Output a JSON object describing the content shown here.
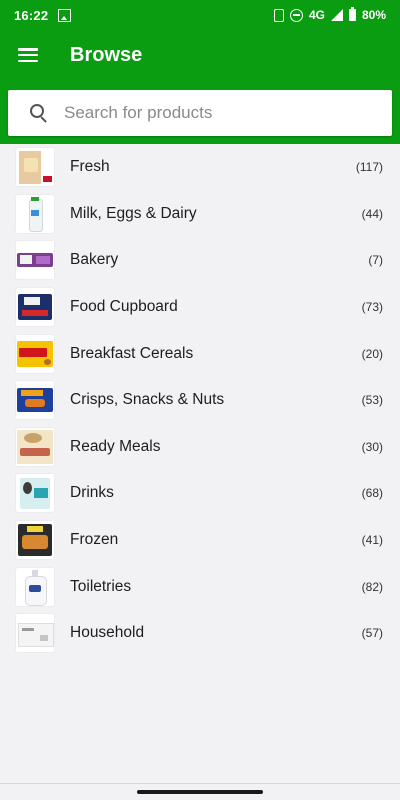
{
  "status_bar": {
    "time": "16:22",
    "network": "4G",
    "battery": "80%"
  },
  "app_bar": {
    "title": "Browse"
  },
  "search": {
    "placeholder": "Search for products",
    "value": ""
  },
  "categories": [
    {
      "name": "Fresh",
      "count": "(117)",
      "icon": "fresh-category-thumbnail"
    },
    {
      "name": "Milk, Eggs & Dairy",
      "count": "(44)",
      "icon": "dairy-category-thumbnail"
    },
    {
      "name": "Bakery",
      "count": "(7)",
      "icon": "bakery-category-thumbnail"
    },
    {
      "name": "Food Cupboard",
      "count": "(73)",
      "icon": "food-cupboard-category-thumbnail"
    },
    {
      "name": "Breakfast Cereals",
      "count": "(20)",
      "icon": "cereals-category-thumbnail"
    },
    {
      "name": "Crisps, Snacks & Nuts",
      "count": "(53)",
      "icon": "snacks-category-thumbnail"
    },
    {
      "name": "Ready Meals",
      "count": "(30)",
      "icon": "ready-meals-category-thumbnail"
    },
    {
      "name": "Drinks",
      "count": "(68)",
      "icon": "drinks-category-thumbnail"
    },
    {
      "name": "Frozen",
      "count": "(41)",
      "icon": "frozen-category-thumbnail"
    },
    {
      "name": "Toiletries",
      "count": "(82)",
      "icon": "toiletries-category-thumbnail"
    },
    {
      "name": "Household",
      "count": "(57)",
      "icon": "household-category-thumbnail"
    }
  ],
  "colors": {
    "brand_green": "#0a9d12",
    "background": "#f2f2f5"
  }
}
